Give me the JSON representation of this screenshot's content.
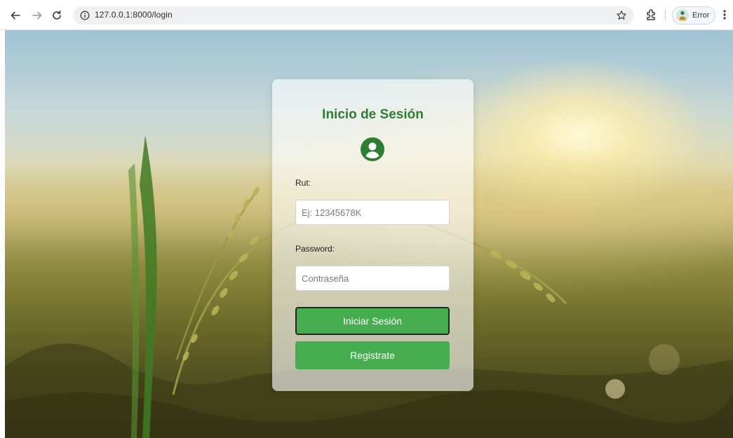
{
  "browser": {
    "url": "127.0.0.1:8000/login",
    "profile_label": "Error"
  },
  "login": {
    "title": "Inicio de Sesión",
    "rut_label": "Rut:",
    "rut_placeholder": "Ej: 12345678K",
    "password_label": "Password:",
    "password_placeholder": "Contraseña",
    "login_button": "Iniciar Sesión",
    "register_button": "Registrate"
  },
  "colors": {
    "primary_green": "#45ad4f",
    "title_green": "#2e7d32"
  },
  "icons": [
    "back-arrow-icon",
    "forward-arrow-icon",
    "reload-icon",
    "info-icon",
    "star-icon",
    "extensions-icon",
    "menu-dots-icon",
    "user-circle-icon"
  ]
}
